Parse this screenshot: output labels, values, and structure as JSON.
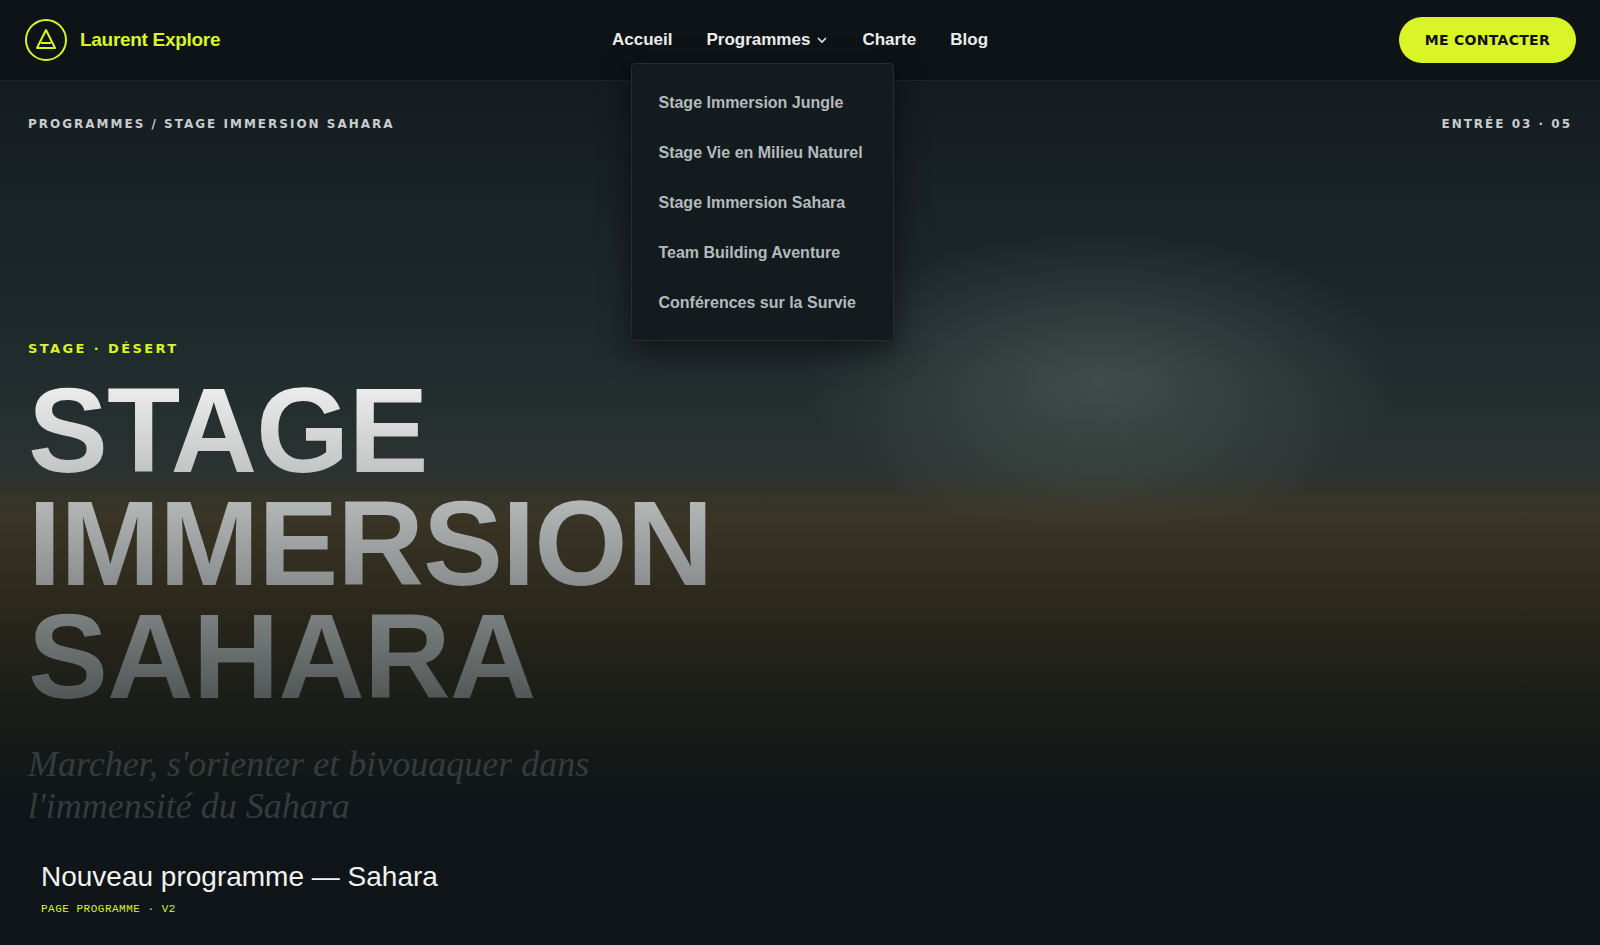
{
  "brand": {
    "name": "Laurent Explore"
  },
  "nav": [
    {
      "label": "Accueil",
      "has_menu": false,
      "expanded": false,
      "items": []
    },
    {
      "label": "Programmes",
      "has_menu": true,
      "expanded": true,
      "items": [
        "Stage Immersion Jungle",
        "Stage Vie en Milieu Naturel",
        "Stage Immersion Sahara",
        "Team Building Aventure",
        "Conférences sur la Survie"
      ]
    },
    {
      "label": "Charte",
      "has_menu": false,
      "expanded": false,
      "items": []
    },
    {
      "label": "Blog",
      "has_menu": false,
      "expanded": false,
      "items": []
    }
  ],
  "cta": "ME CONTACTER",
  "hero": {
    "breadcrumb": "PROGRAMMES / STAGE IMMERSION SAHARA",
    "entry": "ENTRÉE 03 · 05",
    "eyebrow": "STAGE · DÉSERT",
    "title_lines": [
      "STAGE",
      "IMMERSION",
      "SAHARA"
    ],
    "subtitle_lines": [
      "Marcher, s'orienter et bivouaquer dans",
      "l'immensité du Sahara"
    ]
  },
  "caption": {
    "title": "Nouveau programme — Sahara",
    "label": "PAGE PROGRAMME · V2"
  }
}
